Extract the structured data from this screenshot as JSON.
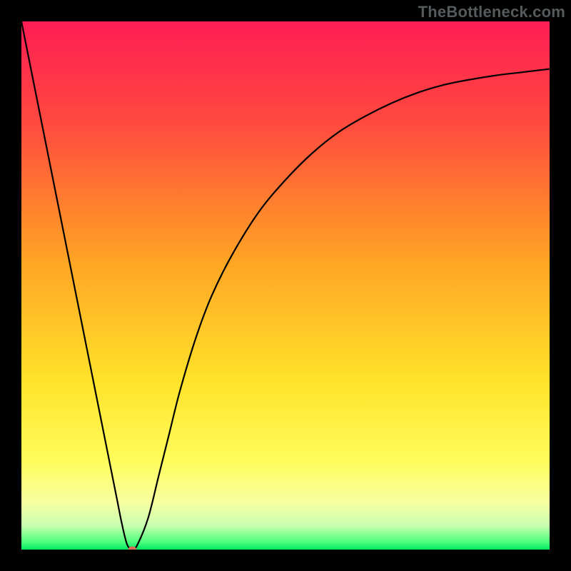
{
  "watermark": "TheBottleneck.com",
  "chart_data": {
    "type": "line",
    "title": "",
    "xlabel": "",
    "ylabel": "",
    "xlim": [
      0,
      100
    ],
    "ylim": [
      0,
      100
    ],
    "x": [
      0,
      2,
      4,
      6,
      8,
      10,
      12,
      14,
      16,
      18,
      19,
      20,
      21,
      22,
      24,
      26,
      28,
      30,
      33,
      36,
      40,
      45,
      50,
      55,
      60,
      65,
      70,
      75,
      80,
      85,
      90,
      95,
      100
    ],
    "values": [
      100,
      90,
      80,
      70,
      60,
      50,
      40,
      30,
      20,
      10,
      5,
      1,
      0,
      1,
      6,
      14,
      22,
      30,
      40,
      48,
      56,
      64,
      70,
      75,
      79,
      82,
      84.5,
      86.5,
      88,
      89,
      89.8,
      90.4,
      91
    ],
    "series": [
      {
        "name": "bottleneck-curve",
        "color": "#000000"
      }
    ],
    "marker": {
      "x": 21,
      "y": 0,
      "color": "#d96b5a"
    },
    "background_gradient": {
      "stops": [
        {
          "pos": 0.0,
          "color": "#ff1d54"
        },
        {
          "pos": 0.18,
          "color": "#ff4640"
        },
        {
          "pos": 0.45,
          "color": "#ffa324"
        },
        {
          "pos": 0.68,
          "color": "#ffe22a"
        },
        {
          "pos": 0.83,
          "color": "#fffc5a"
        },
        {
          "pos": 0.91,
          "color": "#f8ffa0"
        },
        {
          "pos": 0.955,
          "color": "#c8ffb0"
        },
        {
          "pos": 0.985,
          "color": "#4fff7d"
        },
        {
          "pos": 1.0,
          "color": "#00e862"
        }
      ]
    }
  }
}
